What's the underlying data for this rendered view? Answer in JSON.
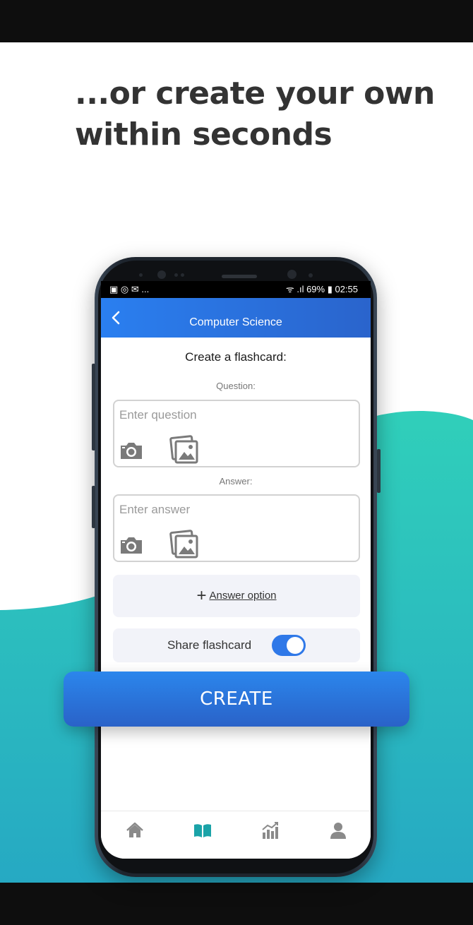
{
  "headline": "...or create your own within seconds",
  "status_bar": {
    "left": "▣ ◎ ✉ ...",
    "right": "ᯤ .ıl 69% ▮ 02:55"
  },
  "header": {
    "title": "Computer Science"
  },
  "form": {
    "title": "Create a flashcard:",
    "question_label": "Question:",
    "question_placeholder": "Enter question",
    "answer_label": "Answer:",
    "answer_placeholder": "Enter answer",
    "answer_option_label": "Answer option",
    "share_label": "Share flashcard",
    "share_enabled": true
  },
  "create_button": "CREATE",
  "bottom_nav": {
    "items": [
      "home-icon",
      "book-icon",
      "stats-icon",
      "profile-icon"
    ],
    "active": "book-icon"
  },
  "colors": {
    "accent": "#2a7ff0",
    "teal": "#2ec9b7",
    "active_nav": "#1aa3a8",
    "inactive_nav": "#8a8a8a"
  }
}
